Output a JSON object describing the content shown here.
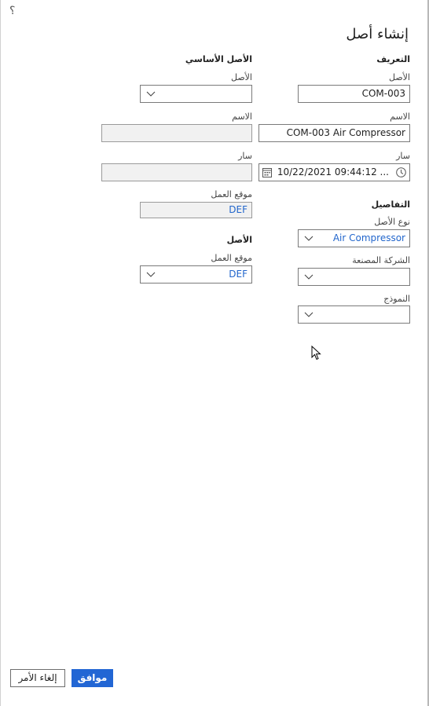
{
  "help_icon": "question-mark",
  "dialog": {
    "title": "إنشاء أصل"
  },
  "identification": {
    "heading": "التعريف",
    "asset_label": "الأصل",
    "asset_value": "COM-003",
    "name_label": "الاسم",
    "name_value": "COM-003 Air Compressor",
    "valid_label": "سار",
    "valid_value": "10/22/2021 09:44:12 ..."
  },
  "details": {
    "heading": "التفاصيل",
    "asset_type_label": "نوع الأصل",
    "asset_type_value": "Air Compressor",
    "manufacturer_label": "الشركة المصنعة",
    "manufacturer_value": "",
    "model_label": "النموذج",
    "model_value": ""
  },
  "parent_asset": {
    "heading": "الأصل الأساسي",
    "asset_label": "الأصل",
    "asset_value": "",
    "name_label": "الاسم",
    "name_value": "",
    "valid_label": "سار",
    "valid_value": "",
    "functional_location_label": "موقع العمل",
    "functional_location_value": "DEF"
  },
  "asset_section": {
    "heading": "الأصل",
    "functional_location_label": "موقع العمل",
    "functional_location_value": "DEF"
  },
  "buttons": {
    "ok": "موافق",
    "cancel": "إلغاء الأمر"
  },
  "colors": {
    "primary": "#2266d4",
    "link": "#2266cc"
  }
}
